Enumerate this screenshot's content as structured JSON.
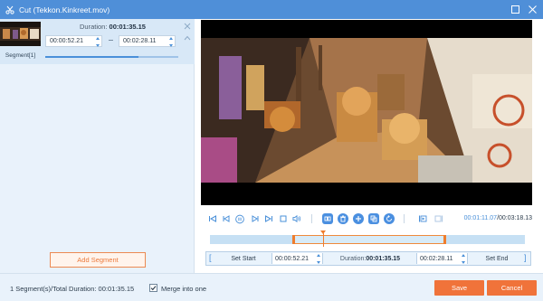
{
  "window": {
    "title": "Cut (Tekkon.Kinkreet.mov)",
    "icon": "scissors-icon",
    "controls": [
      "restore-icon",
      "close-icon"
    ]
  },
  "segment": {
    "label": "Segment[1]",
    "duration_label": "Duration:",
    "duration_value": "00:01:35.15",
    "start": "00:00:52.21",
    "end": "00:02:28.11",
    "progress_fraction": 0.7
  },
  "add_segment_label": "Add Segment",
  "player": {
    "current_time": "00:01:11.07",
    "separator": "/",
    "total_time": "00:03:18.13"
  },
  "timeline": {
    "selection_start_fraction": 0.263,
    "selection_end_fraction": 0.747,
    "playhead_fraction": 0.358
  },
  "cutbar": {
    "set_start_label": "Set Start",
    "start_value": "00:00:52.21",
    "duration_label": "Duration:",
    "duration_value": "00:01:35.15",
    "end_value": "00:02:28.11",
    "set_end_label": "Set End"
  },
  "footer": {
    "summary": "1 Segment(s)/Total Duration: 00:01:35.15",
    "merge_label": "Merge into one",
    "merge_checked": true,
    "save_label": "Save",
    "cancel_label": "Cancel"
  },
  "colors": {
    "titlebar": "#4f8fd8",
    "accent_orange": "#f0733a",
    "accent_blue": "#4a90d9",
    "panel": "#e9f2fb"
  }
}
